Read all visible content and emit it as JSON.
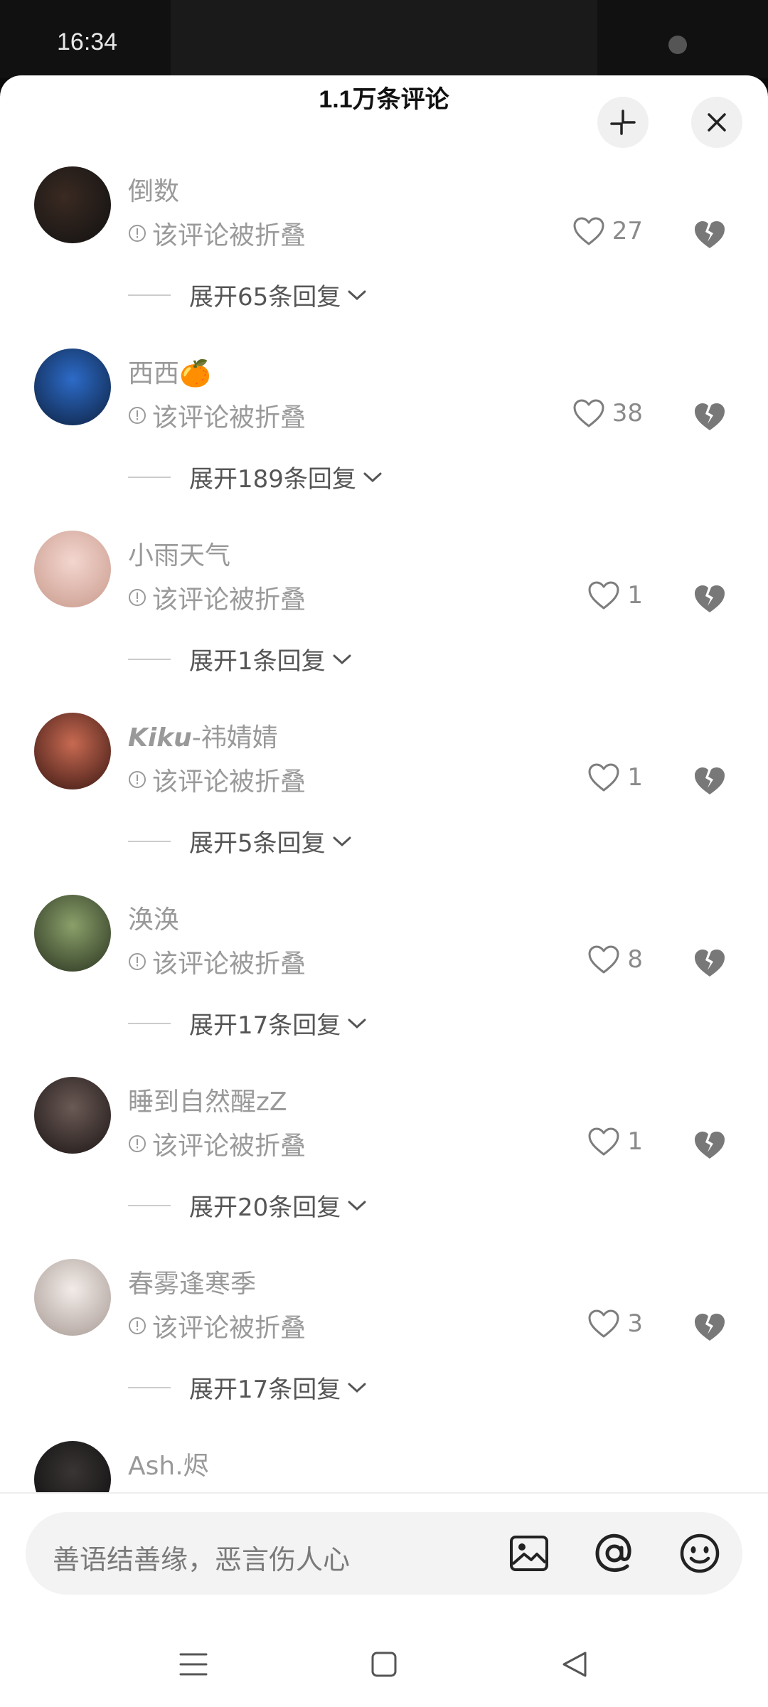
{
  "status_bar": {
    "time": "16:34"
  },
  "header": {
    "title": "1.1万条评论"
  },
  "comments": [
    {
      "name": "倒数",
      "name_bold": "",
      "folded": "该评论被折叠",
      "likes": "27",
      "replies": "展开65条回复",
      "avatar_colors": [
        "#3a2a22",
        "#111"
      ]
    },
    {
      "name": "西西🍊",
      "name_bold": "",
      "folded": "该评论被折叠",
      "likes": "38",
      "replies": "展开189条回复",
      "avatar_colors": [
        "#2d6bc8",
        "#0d2140"
      ]
    },
    {
      "name": "小雨天气",
      "name_bold": "",
      "folded": "该评论被折叠",
      "likes": "1",
      "replies": "展开1条回复",
      "avatar_colors": [
        "#f3d6cf",
        "#c99a8c"
      ]
    },
    {
      "name": "-祎婧婧",
      "name_bold": "Kiku",
      "folded": "该评论被折叠",
      "likes": "1",
      "replies": "展开5条回复",
      "avatar_colors": [
        "#c86a52",
        "#3a1712"
      ]
    },
    {
      "name": "涣涣",
      "name_bold": "",
      "folded": "该评论被折叠",
      "likes": "8",
      "replies": "展开17条回复",
      "avatar_colors": [
        "#8aa06a",
        "#2a3320"
      ]
    },
    {
      "name": "睡到自然醒zZ",
      "name_bold": "",
      "folded": "该评论被折叠",
      "likes": "1",
      "replies": "展开20条回复",
      "avatar_colors": [
        "#6b5a55",
        "#1c1616"
      ]
    },
    {
      "name": "春雾逢寒季",
      "name_bold": "",
      "folded": "该评论被折叠",
      "likes": "3",
      "replies": "展开17条回复",
      "avatar_colors": [
        "#f2ece8",
        "#a89a94"
      ]
    },
    {
      "name": "Ash.烬",
      "name_bold": "",
      "folded": "",
      "likes": "",
      "replies": "",
      "avatar_colors": [
        "#3a3535",
        "#0c0c0c"
      ]
    }
  ],
  "input": {
    "placeholder": "善语结善缘，恶言伤人心"
  },
  "icons": {
    "collapse": "collapse-icon",
    "close": "close-icon",
    "image": "image-icon",
    "mention": "at-icon",
    "emoji": "emoji-icon",
    "menu": "menu-icon",
    "home": "home-icon",
    "back": "back-icon"
  }
}
